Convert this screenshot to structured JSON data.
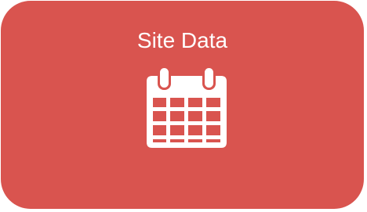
{
  "tile": {
    "title": "Site Data",
    "icon": "calendar-icon",
    "background_color": "#d9544f",
    "icon_color": "#ffffff"
  }
}
